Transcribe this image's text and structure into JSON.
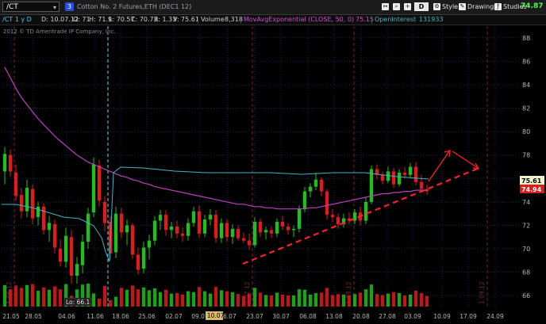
{
  "toolbar": {
    "symbol": "/CT",
    "link_number": "3",
    "instrument_name": "Cotton No. 2 Futures,ETH (DEC1 12)",
    "aggregation": "D",
    "style_label": "Style",
    "drawings_label": "Drawings",
    "studies_label": "Studies"
  },
  "infobar": {
    "period": "/CT 1 y D",
    "date": "D: 10.07.12",
    "open": "O: 71",
    "high": "H: 71.9",
    "low": "L: 70.57",
    "close": "C: 70.73",
    "range": "R: 1.33",
    "v": "V: 75.61",
    "volume_label": "Volume",
    "volume_value": "8,318",
    "mov_avg_label": "MovAvgExponential (CLOSE, 50, 0)",
    "mov_avg_value": "75.15",
    "oi_label": "OpenInterest",
    "oi_value": "131933"
  },
  "copyright": "2012 © TD Ameritrade IP Company, Inc.",
  "price_labels": {
    "last": "74.87",
    "ema": "75.61",
    "current": "74.94",
    "low_marker": "Lo: 66.1",
    "cursor_date": "10.07"
  },
  "colors": {
    "up": "#1fbf1f",
    "down": "#e01b1b",
    "ema": "#c040c0",
    "oi": "#3fb6c4",
    "trendline": "#ff2222",
    "grid": "#0e2a55",
    "vline": "#7a1f3a",
    "text": "#b8b8b8"
  },
  "chart_data": {
    "type": "candlestick",
    "y_axis": {
      "ticks": [
        "88",
        "86",
        "84",
        "82",
        "80",
        "78",
        "76",
        "74",
        "72",
        "70",
        "68",
        "66"
      ],
      "range": [
        65,
        89
      ]
    },
    "x_axis_labels": [
      "21.05",
      "28.05",
      "04.06",
      "11.06",
      "18.06",
      "25.06",
      "02.07",
      "09.07",
      "16.07",
      "23.07",
      "30.07",
      "06.08",
      "13.08",
      "20.08",
      "27.08",
      "03.09",
      "10.09",
      "17.09",
      "24.09"
    ],
    "period_markers": [
      "1.06.12",
      "1.07.12",
      "1.08.12",
      "1.09.12"
    ],
    "candles": [
      {
        "o": 76.6,
        "h": 78.7,
        "l": 75.5,
        "c": 78.1
      },
      {
        "o": 78.0,
        "h": 78.5,
        "l": 76.2,
        "c": 76.6
      },
      {
        "o": 76.5,
        "h": 77.2,
        "l": 74.1,
        "c": 74.5
      },
      {
        "o": 74.6,
        "h": 75.2,
        "l": 72.6,
        "c": 73.2
      },
      {
        "o": 73.2,
        "h": 75.9,
        "l": 72.7,
        "c": 75.2
      },
      {
        "o": 75.1,
        "h": 75.5,
        "l": 72.1,
        "c": 72.6
      },
      {
        "o": 72.7,
        "h": 74.0,
        "l": 72.0,
        "c": 73.6
      },
      {
        "o": 73.6,
        "h": 73.9,
        "l": 71.2,
        "c": 71.6
      },
      {
        "o": 71.6,
        "h": 72.8,
        "l": 70.6,
        "c": 72.2
      },
      {
        "o": 72.1,
        "h": 72.5,
        "l": 69.6,
        "c": 70.1
      },
      {
        "o": 70.0,
        "h": 70.8,
        "l": 68.5,
        "c": 68.9
      },
      {
        "o": 68.9,
        "h": 71.8,
        "l": 68.4,
        "c": 71.1
      },
      {
        "o": 71.0,
        "h": 71.6,
        "l": 67.0,
        "c": 67.7
      },
      {
        "o": 67.7,
        "h": 69.3,
        "l": 67.0,
        "c": 68.7
      },
      {
        "o": 68.6,
        "h": 71.2,
        "l": 67.9,
        "c": 70.6
      },
      {
        "o": 70.6,
        "h": 73.5,
        "l": 70.0,
        "c": 73.0
      },
      {
        "o": 73.1,
        "h": 77.8,
        "l": 72.7,
        "c": 77.2
      },
      {
        "o": 77.1,
        "h": 77.6,
        "l": 73.6,
        "c": 74.1
      },
      {
        "o": 74.0,
        "h": 74.5,
        "l": 71.5,
        "c": 72.2
      },
      {
        "o": 72.3,
        "h": 72.8,
        "l": 69.1,
        "c": 69.6
      },
      {
        "o": 69.7,
        "h": 73.6,
        "l": 69.2,
        "c": 73.0
      },
      {
        "o": 73.0,
        "h": 73.5,
        "l": 70.9,
        "c": 71.4
      },
      {
        "o": 71.4,
        "h": 72.5,
        "l": 70.3,
        "c": 72.0
      },
      {
        "o": 72.0,
        "h": 72.2,
        "l": 69.1,
        "c": 69.5
      },
      {
        "o": 69.5,
        "h": 70.1,
        "l": 67.8,
        "c": 68.2
      },
      {
        "o": 68.3,
        "h": 70.6,
        "l": 67.9,
        "c": 70.1
      },
      {
        "o": 70.1,
        "h": 71.2,
        "l": 69.1,
        "c": 70.7
      },
      {
        "o": 70.7,
        "h": 72.8,
        "l": 70.3,
        "c": 72.4
      },
      {
        "o": 72.4,
        "h": 73.3,
        "l": 71.6,
        "c": 72.9
      },
      {
        "o": 72.9,
        "h": 73.3,
        "l": 71.1,
        "c": 71.6
      },
      {
        "o": 71.6,
        "h": 72.3,
        "l": 70.9,
        "c": 71.9
      },
      {
        "o": 71.9,
        "h": 72.4,
        "l": 70.9,
        "c": 71.3
      },
      {
        "o": 71.3,
        "h": 71.8,
        "l": 70.6,
        "c": 71.1
      },
      {
        "o": 71.1,
        "h": 72.6,
        "l": 70.7,
        "c": 72.2
      },
      {
        "o": 72.2,
        "h": 73.6,
        "l": 71.9,
        "c": 73.2
      },
      {
        "o": 73.2,
        "h": 73.7,
        "l": 70.9,
        "c": 71.3
      },
      {
        "o": 71.3,
        "h": 72.9,
        "l": 71.0,
        "c": 72.5
      },
      {
        "o": 72.5,
        "h": 73.4,
        "l": 72.0,
        "c": 72.9
      },
      {
        "o": 72.9,
        "h": 73.3,
        "l": 70.5,
        "c": 70.9
      },
      {
        "o": 70.9,
        "h": 72.6,
        "l": 70.5,
        "c": 72.2
      },
      {
        "o": 72.2,
        "h": 72.5,
        "l": 70.6,
        "c": 71.0
      },
      {
        "o": 71.0,
        "h": 72.1,
        "l": 70.4,
        "c": 71.7
      },
      {
        "o": 71.7,
        "h": 72.0,
        "l": 70.7,
        "c": 70.9
      },
      {
        "o": 70.9,
        "h": 71.4,
        "l": 70.5,
        "c": 70.7
      },
      {
        "o": 70.7,
        "h": 71.3,
        "l": 69.9,
        "c": 70.3
      },
      {
        "o": 70.3,
        "h": 72.7,
        "l": 70.1,
        "c": 72.3
      },
      {
        "o": 72.3,
        "h": 72.6,
        "l": 71.0,
        "c": 71.4
      },
      {
        "o": 71.4,
        "h": 71.9,
        "l": 70.8,
        "c": 71.6
      },
      {
        "o": 71.6,
        "h": 71.9,
        "l": 70.9,
        "c": 71.3
      },
      {
        "o": 71.3,
        "h": 72.6,
        "l": 71.0,
        "c": 72.3
      },
      {
        "o": 72.3,
        "h": 72.8,
        "l": 71.6,
        "c": 71.9
      },
      {
        "o": 71.9,
        "h": 72.2,
        "l": 71.2,
        "c": 71.6
      },
      {
        "o": 71.6,
        "h": 72.0,
        "l": 71.0,
        "c": 71.7
      },
      {
        "o": 71.7,
        "h": 73.7,
        "l": 71.4,
        "c": 73.4
      },
      {
        "o": 73.4,
        "h": 75.3,
        "l": 73.1,
        "c": 74.9
      },
      {
        "o": 74.9,
        "h": 75.6,
        "l": 74.4,
        "c": 75.3
      },
      {
        "o": 75.3,
        "h": 76.5,
        "l": 75.0,
        "c": 75.9
      },
      {
        "o": 75.9,
        "h": 76.1,
        "l": 74.5,
        "c": 74.9
      },
      {
        "o": 74.9,
        "h": 75.1,
        "l": 72.5,
        "c": 72.9
      },
      {
        "o": 72.9,
        "h": 73.4,
        "l": 72.3,
        "c": 72.7
      },
      {
        "o": 72.7,
        "h": 73.0,
        "l": 71.7,
        "c": 72.1
      },
      {
        "o": 72.1,
        "h": 73.0,
        "l": 71.8,
        "c": 72.6
      },
      {
        "o": 72.6,
        "h": 73.1,
        "l": 72.1,
        "c": 72.4
      },
      {
        "o": 72.4,
        "h": 73.4,
        "l": 72.1,
        "c": 73.1
      },
      {
        "o": 73.1,
        "h": 73.6,
        "l": 72.0,
        "c": 72.4
      },
      {
        "o": 72.4,
        "h": 74.4,
        "l": 72.1,
        "c": 74.0
      },
      {
        "o": 74.0,
        "h": 77.1,
        "l": 73.8,
        "c": 76.8
      },
      {
        "o": 76.8,
        "h": 77.2,
        "l": 75.9,
        "c": 76.3
      },
      {
        "o": 76.3,
        "h": 76.6,
        "l": 75.5,
        "c": 75.8
      },
      {
        "o": 75.8,
        "h": 77.0,
        "l": 75.6,
        "c": 76.6
      },
      {
        "o": 76.6,
        "h": 76.9,
        "l": 75.2,
        "c": 75.5
      },
      {
        "o": 75.5,
        "h": 76.8,
        "l": 75.3,
        "c": 76.5
      },
      {
        "o": 76.5,
        "h": 77.0,
        "l": 76.0,
        "c": 76.3
      },
      {
        "o": 76.3,
        "h": 77.3,
        "l": 76.1,
        "c": 77.0
      },
      {
        "o": 77.0,
        "h": 77.4,
        "l": 75.4,
        "c": 75.7
      },
      {
        "o": 75.7,
        "h": 76.3,
        "l": 74.8,
        "c": 75.1
      },
      {
        "o": 75.1,
        "h": 75.5,
        "l": 74.6,
        "c": 74.9
      }
    ],
    "ema_values": [
      85.5,
      84.6,
      83.7,
      82.9,
      82.3,
      81.7,
      81.1,
      80.6,
      80.1,
      79.6,
      79.2,
      78.8,
      78.4,
      78.0,
      77.7,
      77.4,
      77.2,
      77.0,
      76.8,
      76.6,
      76.4,
      76.2,
      76.1,
      75.9,
      75.8,
      75.6,
      75.5,
      75.3,
      75.2,
      75.1,
      75.0,
      74.9,
      74.8,
      74.7,
      74.6,
      74.5,
      74.4,
      74.3,
      74.2,
      74.1,
      74.0,
      73.9,
      73.8,
      73.8,
      73.7,
      73.6,
      73.6,
      73.5,
      73.5,
      73.4,
      73.4,
      73.4,
      73.4,
      73.4,
      73.4,
      73.5,
      73.5,
      73.6,
      73.7,
      73.8,
      73.9,
      74.0,
      74.1,
      74.2,
      74.3,
      74.4,
      74.5,
      74.6,
      74.7,
      74.7,
      74.8,
      74.8,
      74.9,
      74.9,
      75.0,
      75.0,
      75.0
    ]
  }
}
